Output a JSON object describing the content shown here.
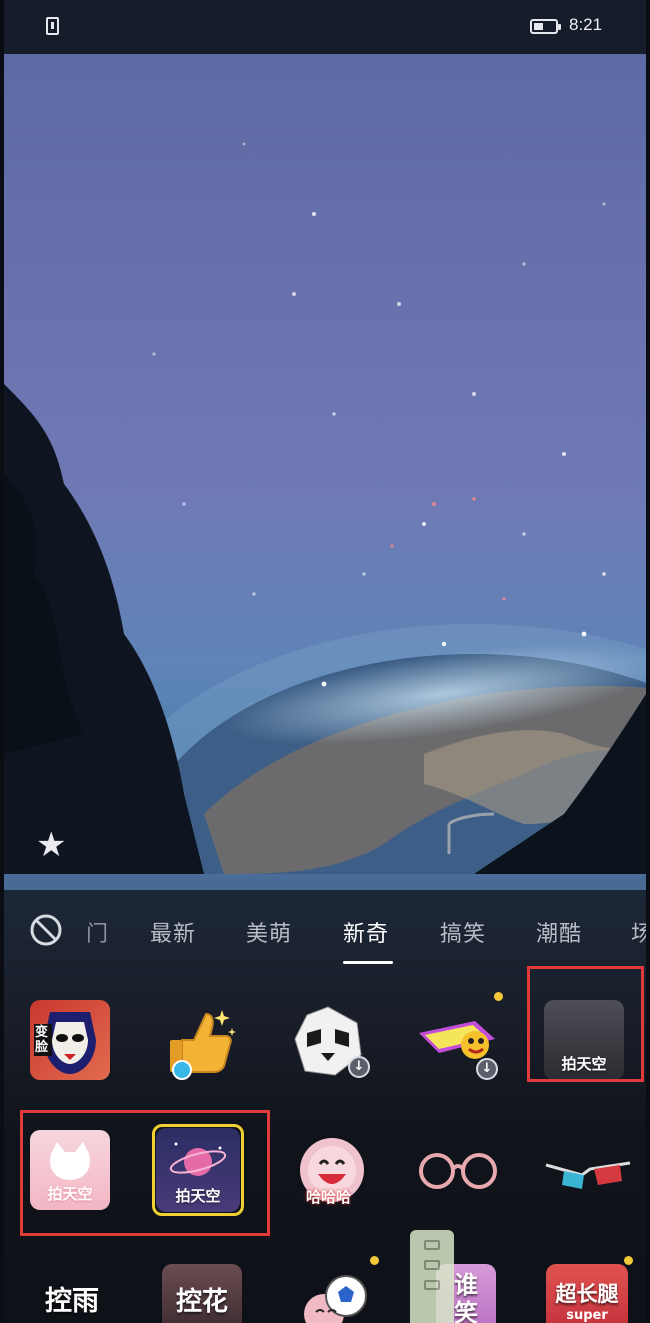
{
  "status_bar": {
    "time": "8:21"
  },
  "tabs": [
    "门",
    "最新",
    "美萌",
    "新奇",
    "搞笑",
    "潮酷",
    "场"
  ],
  "active_tab": "新奇",
  "effects": {
    "row1": [
      {
        "name": "face-change",
        "label": "变脸"
      },
      {
        "name": "thumbs-up",
        "label": ""
      },
      {
        "name": "panda",
        "label": ""
      },
      {
        "name": "sticker-card",
        "label": ""
      },
      {
        "name": "shoot-sky-a",
        "label": "拍天空"
      }
    ],
    "row2": [
      {
        "name": "shoot-sky-cat",
        "label": "拍天空"
      },
      {
        "name": "shoot-sky-planet",
        "label": "拍天空"
      },
      {
        "name": "haha",
        "label": "哈哈哈"
      },
      {
        "name": "glasses",
        "label": ""
      },
      {
        "name": "3d-glasses",
        "label": ""
      }
    ],
    "row3": [
      {
        "name": "control-rain",
        "label": "控雨"
      },
      {
        "name": "control-flower",
        "label": "控花"
      },
      {
        "name": "football",
        "label": ""
      },
      {
        "name": "who",
        "label": "谁笑"
      },
      {
        "name": "long-legs",
        "label": "超长腿",
        "sub": "super"
      }
    ]
  },
  "colors": {
    "highlight": "#e23a3a",
    "selected": "#f0cf35",
    "badge": "#f3c93a"
  }
}
